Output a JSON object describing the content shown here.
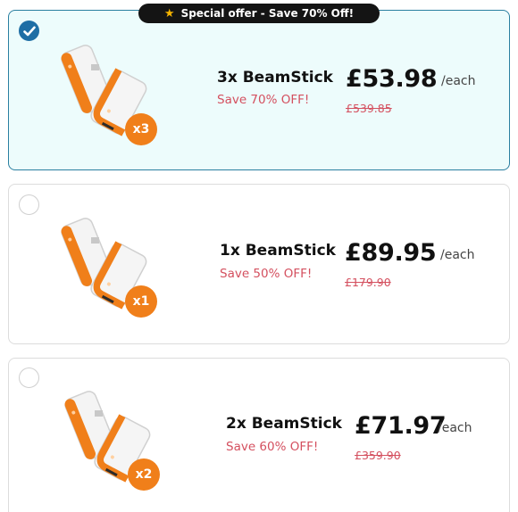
{
  "offer_badge": {
    "icon": "star-icon",
    "text": "Special offer - Save 70% Off!"
  },
  "options": [
    {
      "name": "3x BeamStick",
      "save": "Save 70% OFF!",
      "price": "£53.98",
      "unit": "/each",
      "old_price": "£539.85",
      "qty_badge": "x3",
      "selected": true
    },
    {
      "name": "1x BeamStick",
      "save": "Save 50% OFF!",
      "price": "£89.95",
      "unit": "/each",
      "old_price": "£179.90",
      "qty_badge": "x1",
      "selected": false
    },
    {
      "name": "2x BeamStick",
      "save": "Save 60% OFF!",
      "price": "£71.97",
      "unit": "/each",
      "old_price": "£359.90",
      "qty_badge": "x2",
      "selected": false
    }
  ],
  "colors": {
    "accent_orange": "#f07f1a",
    "selected_border": "#2a7fa0",
    "selected_bg": "#edfcfc",
    "save_red": "#d4505f",
    "radio_checked": "#1e6ea5"
  }
}
